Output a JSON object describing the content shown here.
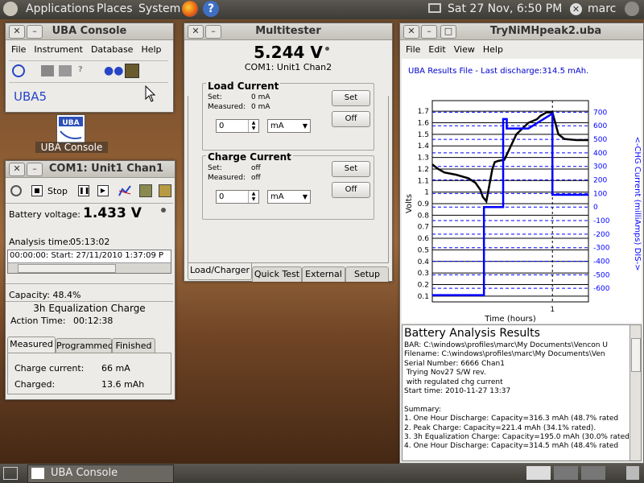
{
  "top_panel": {
    "menus": [
      "Applications",
      "Places",
      "System"
    ],
    "clock": "Sat 27 Nov,  6:50 PM",
    "user": "marc"
  },
  "bottom_panel": {
    "task_label": "UBA Console"
  },
  "desktop_icon": {
    "label": "UBA Console"
  },
  "uba_console": {
    "title": "UBA Console",
    "menu": [
      "File",
      "Instrument",
      "Database",
      "Help"
    ],
    "device": "UBA5"
  },
  "unit_window": {
    "title": "COM1: Unit1 Chan1",
    "stop_label": "Stop",
    "battery_voltage_label": "Battery voltage:",
    "battery_voltage": "1.433 V",
    "analysis_time_label": "Analysis time:",
    "analysis_time": "05:13:02",
    "log_entry": "00:00:00:  Start: 27/11/2010 1:37:09 P",
    "capacity": "Capacity: 48.4%",
    "phase": "3h Equalization Charge",
    "action_time_label": "Action Time:",
    "action_time": "00:12:38",
    "tabs": [
      "Measured",
      "Programmed",
      "Finished"
    ],
    "charge_current_label": "Charge current:",
    "charge_current": "66 mA",
    "charged_label": "Charged:",
    "charged": "13.6 mAh"
  },
  "multitester": {
    "title": "Multitester",
    "voltage": "5.244 V",
    "channel": "COM1: Unit1 Chan2",
    "load": {
      "heading": "Load Current",
      "set_label": "Set:",
      "set_value": "0 mA",
      "measured_label": "Measured:",
      "measured_value": "0 mA",
      "input": "0",
      "unit": "mA",
      "set_button": "Set",
      "off_button": "Off"
    },
    "charge": {
      "heading": "Charge Current",
      "set_label": "Set:",
      "set_value": "off",
      "measured_label": "Measured:",
      "measured_value": "off",
      "input": "0",
      "unit": "mA",
      "set_button": "Set",
      "off_button": "Off"
    },
    "tabs": [
      "Load/Charger",
      "Quick Test",
      "External",
      "Setup"
    ]
  },
  "plot_window": {
    "title": "TryNiMHpeak2.uba",
    "menu": [
      "File",
      "Edit",
      "View",
      "Help"
    ],
    "chart_title": "UBA Results File - Last discharge:314.5 mAh.",
    "results_title": "Battery Analysis Results",
    "results_lines": [
      "BAR: C:\\windows\\profiles\\marc\\My Documents\\Vencon U",
      "Filename: C:\\windows\\profiles\\marc\\My Documents\\Ven",
      "Serial Number: 6666 Chan1",
      " Trying Nov27 S/W rev.",
      " with regulated chg current",
      "Start time: 2010-11-27 13:37",
      "",
      "Summary:",
      "1. One Hour Discharge: Capacity=316.3 mAh (48.7% rated",
      "2. Peak Charge: Capacity=221.4 mAh (34.1% rated).",
      "3. 3h Equalization Charge: Capacity=195.0 mAh (30.0% rated",
      "4. One Hour Discharge: Capacity=314.5 mAh (48.4% rated"
    ]
  },
  "chart_data": {
    "type": "line",
    "title": "UBA Results File - Last discharge:314.5 mAh.",
    "xlabel": "Time (hours)",
    "ylabel": "Volts",
    "y2label": "<-CHG  Current (milliAmps)  DIS->",
    "xlim": [
      0,
      1.3
    ],
    "x_ticks": [
      1
    ],
    "ylim": [
      0.05,
      1.75
    ],
    "y_ticks": [
      0.1,
      0.2,
      0.3,
      0.4,
      0.5,
      0.6,
      0.7,
      0.8,
      0.9,
      1.0,
      1.1,
      1.2,
      1.3,
      1.4,
      1.5,
      1.6,
      1.7
    ],
    "y_tick_labels": [
      "0.1",
      "0.2",
      "0.3",
      "0.4",
      "0.5",
      "0.6",
      "0.7",
      "0.8",
      "0.9",
      "1",
      "1.1",
      "1.2",
      "1.3",
      "1.4",
      "1.5",
      "1.6",
      "1.7"
    ],
    "y2lim": [
      -700,
      750
    ],
    "y2_ticks": [
      -600,
      -500,
      -400,
      -300,
      -200,
      -100,
      0,
      100,
      200,
      300,
      400,
      500,
      600,
      700
    ],
    "grid": true,
    "series": [
      {
        "axis": "left",
        "color": "#000000",
        "x": [
          0,
          0.05,
          0.1,
          0.2,
          0.3,
          0.36,
          0.4,
          0.42,
          0.45,
          0.5,
          0.52,
          0.55,
          0.6,
          0.7,
          0.8,
          0.87,
          0.9,
          0.95,
          1.0,
          1.05,
          1.1,
          1.2,
          1.3
        ],
        "y": [
          1.24,
          1.2,
          1.17,
          1.15,
          1.12,
          1.08,
          1.02,
          0.96,
          0.92,
          1.2,
          1.26,
          1.27,
          1.28,
          1.5,
          1.6,
          1.63,
          1.66,
          1.69,
          1.69,
          1.5,
          1.46,
          1.45,
          1.45
        ]
      },
      {
        "axis": "right",
        "color": "#0000ff",
        "x": [
          0,
          0.43,
          0.43,
          0.59,
          0.59,
          0.62,
          0.62,
          0.8,
          1.0,
          1.0,
          1.3
        ],
        "y": [
          -650,
          -650,
          0,
          0,
          650,
          650,
          580,
          580,
          690,
          90,
          90
        ]
      }
    ]
  }
}
